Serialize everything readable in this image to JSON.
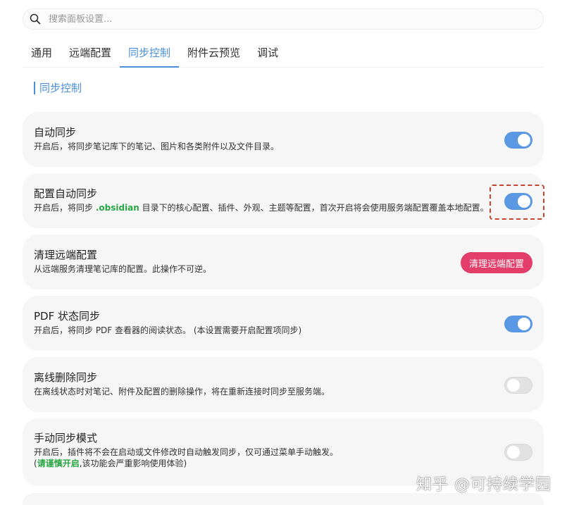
{
  "search": {
    "placeholder": "搜索面板设置..."
  },
  "tabs": [
    {
      "label": "通用"
    },
    {
      "label": "远端配置"
    },
    {
      "label": "同步控制",
      "active": true
    },
    {
      "label": "附件云预览"
    },
    {
      "label": "调试"
    }
  ],
  "section": {
    "title": "同步控制"
  },
  "settings": {
    "auto_sync": {
      "title": "自动同步",
      "desc": "开启后，将同步笔记库下的笔记、图片和各类附件以及文件目录。",
      "enabled": true
    },
    "config_auto_sync": {
      "title": "配置自动同步",
      "desc_prefix": "开启后，将同步 ",
      "desc_highlight": ".obsidian",
      "desc_suffix": " 目录下的核心配置、插件、外观、主题等配置，首次开启将会使用服务端配置覆盖本地配置。",
      "enabled": true
    },
    "clean_remote": {
      "title": "清理远端配置",
      "desc": "从远端服务清理笔记库的配置。此操作不可逆。",
      "button_label": "清理远端配置"
    },
    "pdf_sync": {
      "title": "PDF 状态同步",
      "desc": "开启后，将同步 PDF 查看器的阅读状态。 (本设置需要开启配置项同步)",
      "enabled": true
    },
    "offline_delete": {
      "title": "离线删除同步",
      "desc": "在离线状态时对笔记、附件及配置的删除操作，将在重新连接时同步至服务端。",
      "enabled": false
    },
    "manual_sync": {
      "title": "手动同步模式",
      "desc_line1": "开启后，插件将不会在启动或文件修改时自动触发同步，仅可通过菜单手动触发。",
      "desc_line2_open": "(",
      "desc_line2_highlight": "请谨慎开启",
      "desc_line2_rest": ",该功能会严重影响使用体验)",
      "enabled": false
    }
  },
  "watermark": "知乎 @可持续学园",
  "colors": {
    "accent": "#4a8fd8",
    "toggle_on": "#5b98e4",
    "danger": "#e23e69",
    "highlight_green": "#2aa744",
    "annotation_red": "#c9432e"
  }
}
